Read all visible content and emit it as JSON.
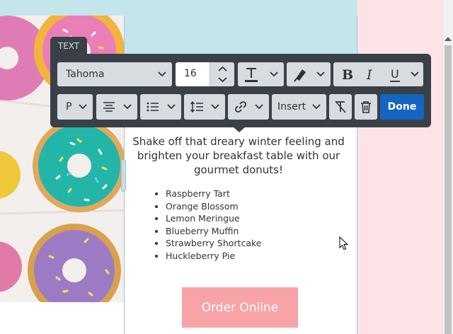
{
  "toolbar": {
    "tab_label": "TEXT",
    "font_family": "Tahoma",
    "font_size": "16",
    "block_format": "P",
    "insert_label": "Insert",
    "done_label": "Done",
    "icons": [
      "text-color-icon",
      "highlight-icon",
      "bold-icon",
      "italic-icon",
      "underline-icon",
      "align-center-icon",
      "list-icon",
      "line-height-icon",
      "link-icon",
      "clear-format-icon",
      "trash-icon"
    ]
  },
  "content": {
    "paragraph": "Shake off that dreary winter feeling and brighten your breakfast table with our gourmet donuts!",
    "items": [
      "Raspberry Tart",
      "Orange Blossom",
      "Lemon Meringue",
      "Blueberry Muffin",
      "Strawberry Shortcake",
      "Huckleberry Pie"
    ],
    "order_button": "Order Online"
  },
  "colors": {
    "toolbar_bg": "#3a4048",
    "control_bg": "#d8dbe0",
    "done_bg": "#1565c0",
    "order_bg": "#f8a3a8",
    "section_blue": "#c5e5ec",
    "section_pink": "#fde3e6"
  }
}
